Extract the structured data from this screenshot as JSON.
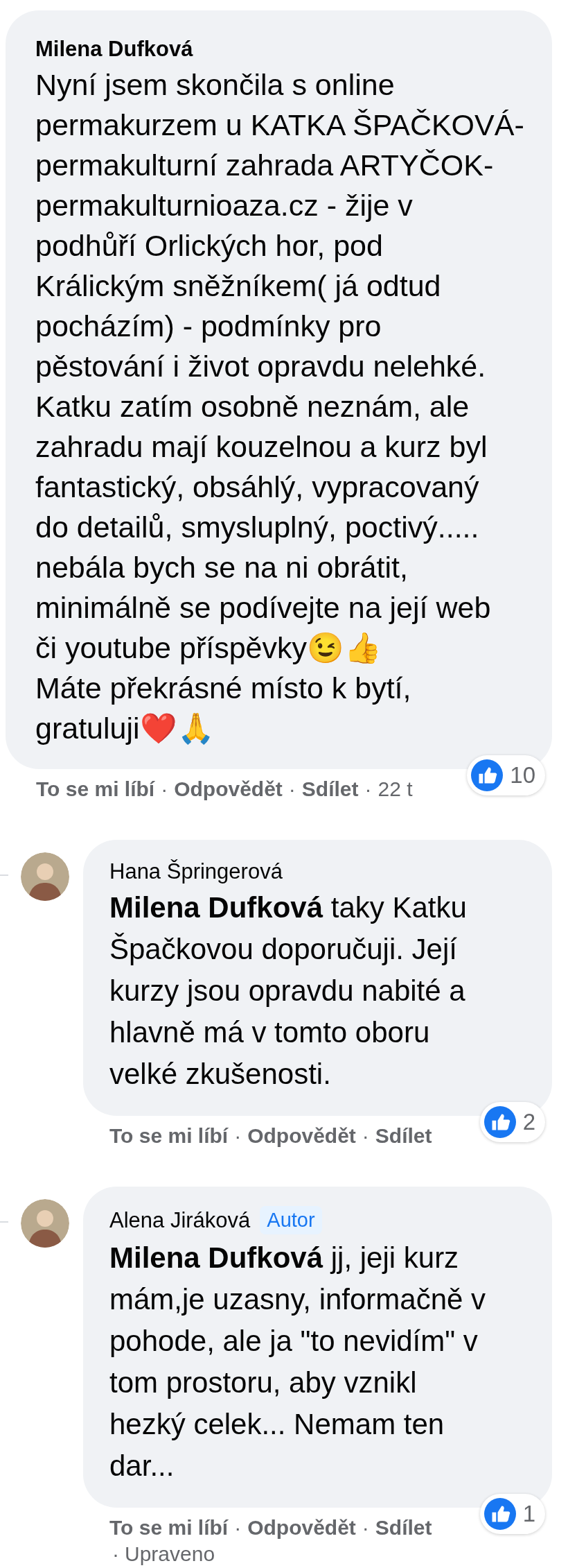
{
  "separator": "·",
  "comment": {
    "author": "Milena Dufková",
    "text": "Nyní jsem skončila s online\npermakurzem u KATKA ŠPAČKOVÁ-\npermakulturní zahrada ARTYČOK-\npermakulturnioaza.cz - žije v\npodhůří Orlických hor, pod\nKrálickým sněžníkem( já odtud\npocházím) - podmínky pro\npěstování i život opravdu nelehké.\nKatku zatím osobně neznám, ale\nzahradu mají kouzelnou a kurz byl\nfantastický, obsáhlý, vypracovaný\ndo detailů, smysluplný, poctivý.....\nnebála bych se na ni obrátit,\nminimálně se podívejte na její web\nči youtube příspěvky😉👍\nMáte překrásné místo k bytí,\ngratuluji❤️🙏",
    "likes": "10",
    "actions": [
      "To se mi líbí",
      "Odpovědět",
      "Sdílet"
    ],
    "time": "22 t"
  },
  "replies": [
    {
      "author": "Hana Špringerová",
      "text": "**Milena Dufková** taky Katku\nŠpačkovou doporučuji. Její\nkurzy jsou opravdu nabité a\nhlavně má v tomto oboru\nvelké zkušenosti.",
      "likes": "2",
      "actions": [
        "To se mi líbí",
        "Odpovědět",
        "Sdílet"
      ]
    },
    {
      "author": "Alena Jiráková",
      "badge": "Autor",
      "text": "**Milena Dufková** jj, jeji kurz\nmám,je uzasny, informačně v\npohode, ale ja \"to nevidím\" v\ntom prostoru, aby vznikl\nhezký celek... Nemam ten\ndar...",
      "likes": "1",
      "actions": [
        "To se mi líbí",
        "Odpovědět",
        "Sdílet"
      ],
      "edited": "Upraveno"
    }
  ]
}
